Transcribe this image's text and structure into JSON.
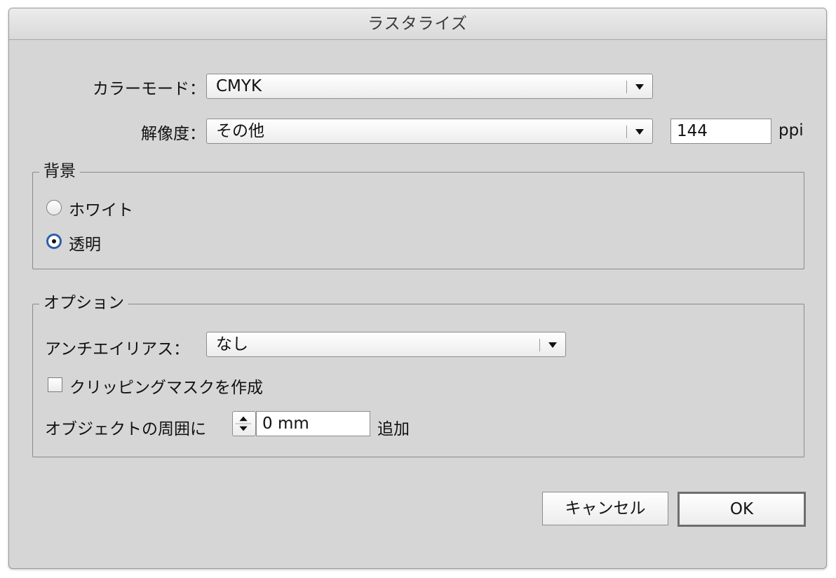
{
  "dialog": {
    "title": "ラスタライズ"
  },
  "color_mode": {
    "label": "カラーモード：",
    "value": "CMYK"
  },
  "resolution": {
    "label": "解像度：",
    "value": "その他",
    "ppi_value": "144",
    "unit": "ppi"
  },
  "background": {
    "legend": "背景",
    "options": [
      {
        "label": "ホワイト",
        "selected": false
      },
      {
        "label": "透明",
        "selected": true
      }
    ]
  },
  "options": {
    "legend": "オプション",
    "antialias": {
      "label": "アンチエイリアス：",
      "value": "なし"
    },
    "clipping_mask": {
      "label": "クリッピングマスクを作成",
      "checked": false
    },
    "padding": {
      "label": "オブジェクトの周囲に",
      "value": "0 mm",
      "suffix": "追加"
    }
  },
  "buttons": {
    "cancel": "キャンセル",
    "ok": "OK"
  },
  "colors": {
    "radio_selected_ring": "#2f5fa8",
    "dialog_bg": "#d6d6d6"
  }
}
